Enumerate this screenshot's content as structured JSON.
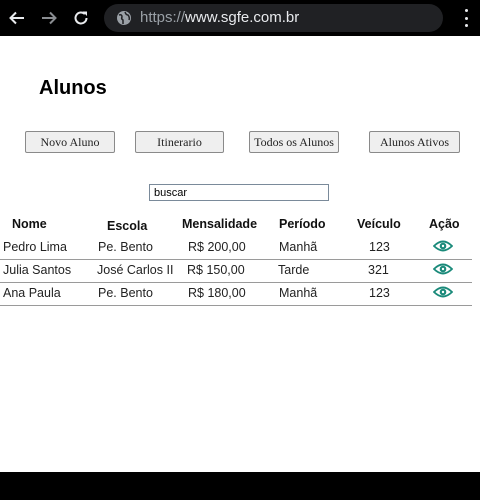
{
  "browser": {
    "url_scheme": "https://",
    "url_host": "www.sgfe.com.br",
    "icons": {
      "back": "arrow-left-icon",
      "forward": "arrow-right-icon",
      "reload": "reload-icon",
      "site": "globe-icon",
      "menu": "kebab-menu-icon"
    }
  },
  "page": {
    "title": "Alunos",
    "buttons": {
      "novo_aluno": "Novo Aluno",
      "itinerario": "Itinerario",
      "todos": "Todos os Alunos",
      "ativos": "Alunos Ativos"
    },
    "search": {
      "value": "buscar"
    },
    "table": {
      "headers": [
        "Nome",
        "Escola",
        "Mensalidade",
        "Período",
        "Veículo",
        "Ação"
      ],
      "rows": [
        [
          "Pedro Lima",
          "Pe. Bento",
          "R$ 200,00",
          "Manhã",
          "123"
        ],
        [
          "Julia Santos",
          "José Carlos II",
          "R$ 150,00",
          "Tarde",
          "321"
        ],
        [
          "Ana Paula",
          "Pe. Bento",
          "R$ 180,00",
          "Manhã",
          "123"
        ]
      ],
      "action_icon": "eye-icon",
      "action_color": "#1a8a7a"
    }
  }
}
